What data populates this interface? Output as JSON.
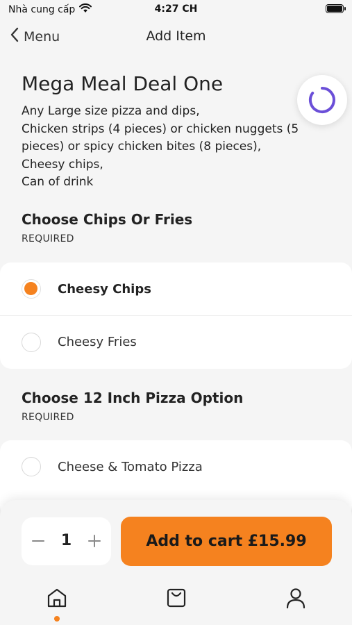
{
  "status_bar": {
    "carrier": "Nhà cung cấp",
    "time": "4:27 CH"
  },
  "nav": {
    "back_label": "Menu",
    "title": "Add Item"
  },
  "item": {
    "title": "Mega Meal Deal One",
    "description": "Any Large size pizza and dips,\nChicken strips (4 pieces) or chicken nuggets (5 pieces) or spicy chicken bites (8 pieces),\nCheesy chips,\nCan of drink"
  },
  "sections": [
    {
      "title": "Choose Chips Or Fries",
      "subtitle": "REQUIRED",
      "options": [
        {
          "label": "Cheesy Chips",
          "selected": true
        },
        {
          "label": "Cheesy Fries",
          "selected": false
        }
      ]
    },
    {
      "title": "Choose 12 Inch Pizza Option",
      "subtitle": "REQUIRED",
      "options": [
        {
          "label": "Cheese & Tomato Pizza",
          "selected": false
        }
      ]
    }
  ],
  "cart": {
    "quantity": "1",
    "add_label": "Add to cart £15.99"
  },
  "tabs": {
    "active": "home",
    "items": [
      "home-icon",
      "cart-icon",
      "profile-icon"
    ]
  },
  "colors": {
    "accent": "#f5821f",
    "spinner": "#6b4fd8"
  }
}
